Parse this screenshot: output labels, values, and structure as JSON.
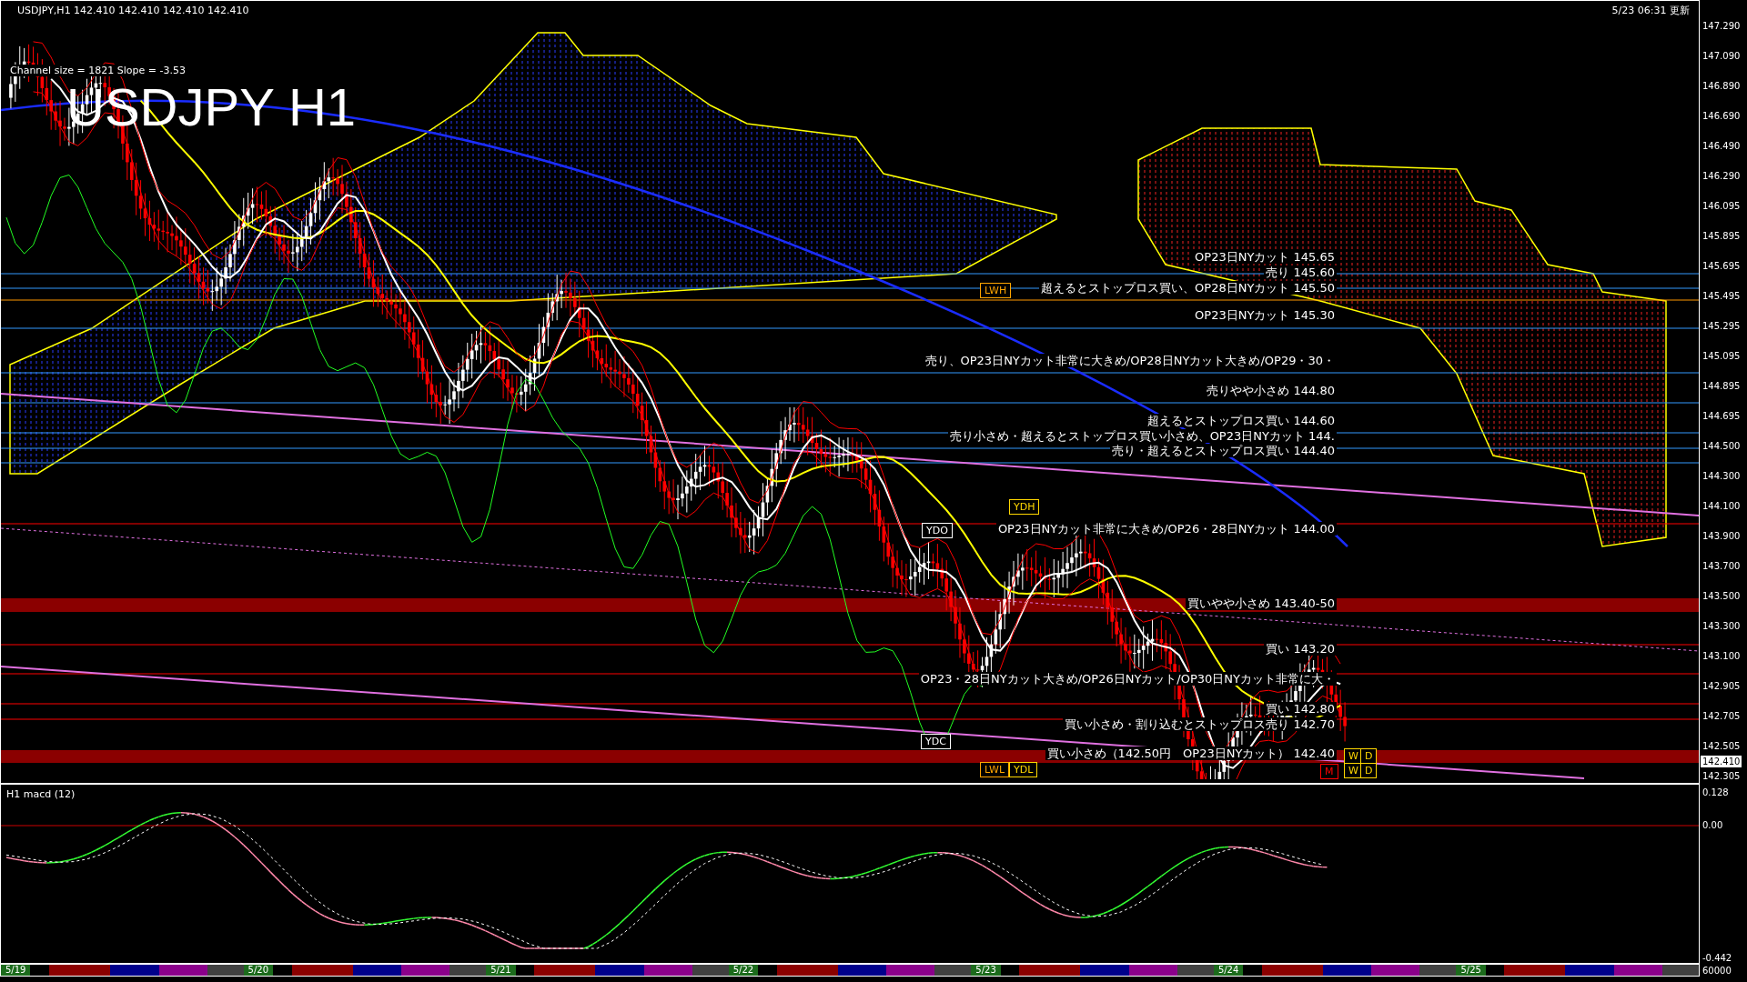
{
  "header": {
    "symbol_line": "USDJPY,H1  142.410 142.410 142.410 142.410",
    "updated": "5/23 06:31 更新",
    "channel_info": "Channel size = 1821 Slope = -3.53",
    "big_title": "USDJPY H1"
  },
  "levels": [
    {
      "text": "OP23日NYカット 145.65"
    },
    {
      "text": "売り 145.60"
    },
    {
      "text": "超えるとストップロス買い、OP28日NYカット 145.50"
    },
    {
      "text": "OP23日NYカット 145.30"
    },
    {
      "text": "売り、OP23日NYカット非常に大きめ/OP28日NYカット大きめ/OP29・30・"
    },
    {
      "text": "売りやや小さめ 144.80"
    },
    {
      "text": "超えるとストップロス買い 144.60"
    },
    {
      "text": "売り小さめ・超えるとストップロス買い小さめ、OP23日NYカット 144."
    },
    {
      "text": "売り・超えるとストップロス買い 144.40"
    },
    {
      "text": "OP23日NYカット非常に大きめ/OP26・28日NYカット 144.00"
    },
    {
      "text": "買いやや小さめ 143.40-50"
    },
    {
      "text": "買い 143.20"
    },
    {
      "text": "OP23・28日NYカット大きめ/OP26日NYカット/OP30日NYカット非常に大・"
    },
    {
      "text": "買い 142.80"
    },
    {
      "text": "買い小さめ・割り込むとストップロス売り 142.70"
    },
    {
      "text": "買い小さめ（142.50円　OP23日NYカット） 142.40"
    }
  ],
  "tags": [
    {
      "label": "LWH",
      "color": "#ffa500"
    },
    {
      "label": "YDH",
      "color": "#ffd700"
    },
    {
      "label": "YDO",
      "color": "#ffffff"
    },
    {
      "label": "YDC",
      "color": "#ffffff"
    },
    {
      "label": "LWL",
      "color": "#ffa500"
    },
    {
      "label": "YDL",
      "color": "#ffd700"
    },
    {
      "label": "W",
      "color": "#ffd700"
    },
    {
      "label": "D",
      "color": "#ffd700"
    },
    {
      "label": "M",
      "color": "#ff0000"
    },
    {
      "label": "W",
      "color": "#ffd700"
    },
    {
      "label": "D",
      "color": "#ffd700"
    }
  ],
  "price_axis": {
    "labels": [
      "147.290",
      "147.090",
      "146.890",
      "146.690",
      "146.490",
      "146.290",
      "146.095",
      "145.895",
      "145.695",
      "145.495",
      "145.295",
      "145.095",
      "144.895",
      "144.695",
      "144.500",
      "144.300",
      "144.100",
      "143.900",
      "143.700",
      "143.500",
      "143.300",
      "143.100",
      "142.905",
      "142.705",
      "142.505",
      "142.305"
    ],
    "current_price": "142.410"
  },
  "macd": {
    "title": "H1 macd (12)",
    "labels": [
      "0.128",
      "0.00",
      "-0.442"
    ],
    "volume_label": "60000"
  },
  "dates": [
    "5/19",
    "5/20",
    "5/21",
    "5/22",
    "5/23",
    "5/24",
    "5/25"
  ]
}
